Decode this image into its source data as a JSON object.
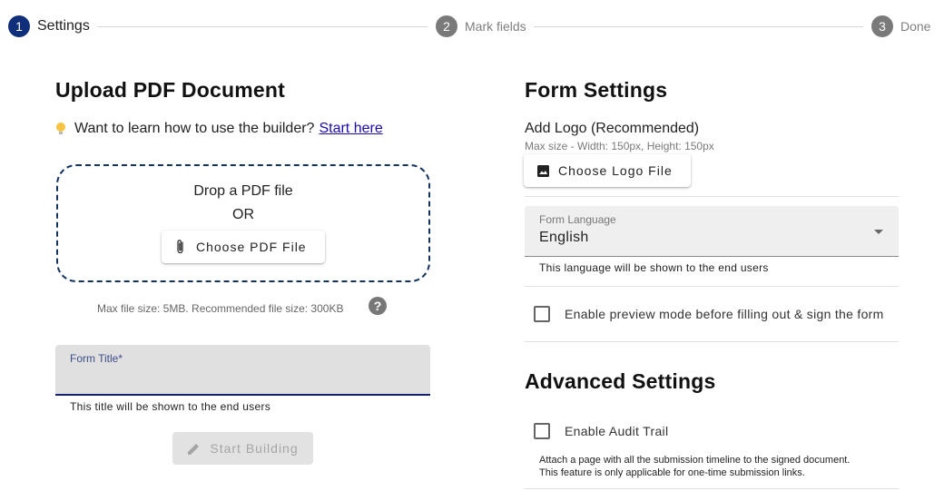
{
  "stepper": {
    "steps": [
      {
        "number": "1",
        "label": "Settings"
      },
      {
        "number": "2",
        "label": "Mark fields"
      },
      {
        "number": "3",
        "label": "Done"
      }
    ],
    "active_index": 0,
    "colors": {
      "active": "#0f2f7a",
      "inactive": "#7a7a7a"
    }
  },
  "upload": {
    "heading": "Upload PDF Document",
    "hint_text": "Want to learn how to use the builder?",
    "hint_link": "Start here",
    "hint_icon": "lightbulb-icon",
    "drop_text": "Drop a PDF file",
    "or_text": "OR",
    "choose_button": "Choose PDF File",
    "choose_icon": "paperclip-icon",
    "max_size_text": "Max file size: 5MB. Recommended file size: 300KB",
    "help_icon": "help-icon",
    "help_glyph": "?"
  },
  "form_title": {
    "label": "Form Title*",
    "value": "",
    "helper": "This title will be shown to the end users"
  },
  "start_button": {
    "label": "Start Building",
    "icon": "pencil-icon",
    "disabled": true
  },
  "form_settings": {
    "heading": "Form Settings",
    "logo_label": "Add Logo (Recommended)",
    "logo_sub": "Max size - Width: 150px, Height: 150px",
    "logo_button": "Choose Logo File",
    "logo_icon": "image-icon",
    "language_label": "Form Language",
    "language_value": "English",
    "language_helper": "This language will be shown to the end users",
    "preview_label": "Enable preview mode before filling out & sign the form",
    "preview_checked": false
  },
  "advanced": {
    "heading": "Advanced Settings",
    "audit_label": "Enable Audit Trail",
    "audit_checked": false,
    "audit_desc_1": "Attach a page with all the submission timeline to the signed document.",
    "audit_desc_2": "This feature is only applicable for one-time submission links."
  }
}
